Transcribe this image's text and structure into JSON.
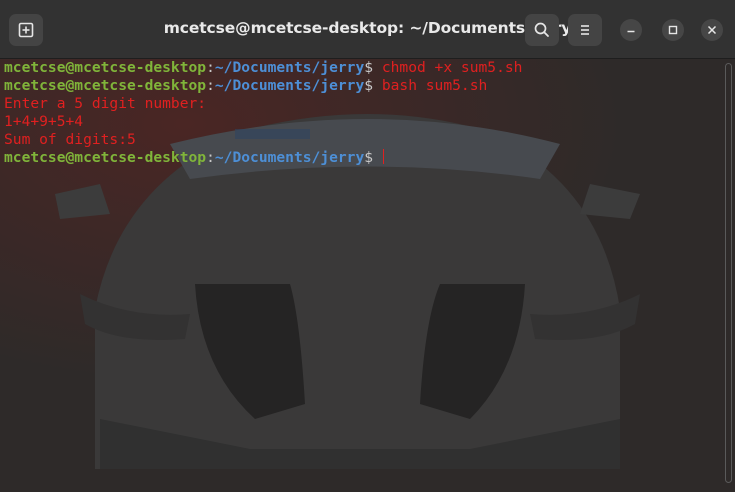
{
  "titlebar": {
    "title": "mcetcse@mcetcse-desktop: ~/Documents/jerry",
    "new_tab_icon": "new-tab-icon",
    "search_icon": "search-icon",
    "menu_icon": "hamburger-menu-icon",
    "minimize_icon": "minimize-icon",
    "maximize_icon": "maximize-icon",
    "close_icon": "close-icon"
  },
  "terminal": {
    "lines": [
      {
        "type": "prompt",
        "user": "mcetcse@mcetcse-desktop",
        "colon": ":",
        "path": "~/Documents/jerry",
        "dollar": "$ ",
        "cmd": "chmod +x sum5.sh"
      },
      {
        "type": "prompt",
        "user": "mcetcse@mcetcse-desktop",
        "colon": ":",
        "path": "~/Documents/jerry",
        "dollar": "$ ",
        "cmd": "bash sum5.sh"
      },
      {
        "type": "output",
        "text": "Enter a 5 digit number:"
      },
      {
        "type": "output",
        "text": "1+4+9+5+4"
      },
      {
        "type": "output",
        "text": "Sum of digits:5"
      },
      {
        "type": "prompt",
        "user": "mcetcse@mcetcse-desktop",
        "colon": ":",
        "path": "~/Documents/jerry",
        "dollar": "$ ",
        "cmd": ""
      }
    ]
  },
  "colors": {
    "user": "#80b53a",
    "path": "#4d8fd6",
    "text": "#e02020",
    "background": "#2e2a29"
  }
}
